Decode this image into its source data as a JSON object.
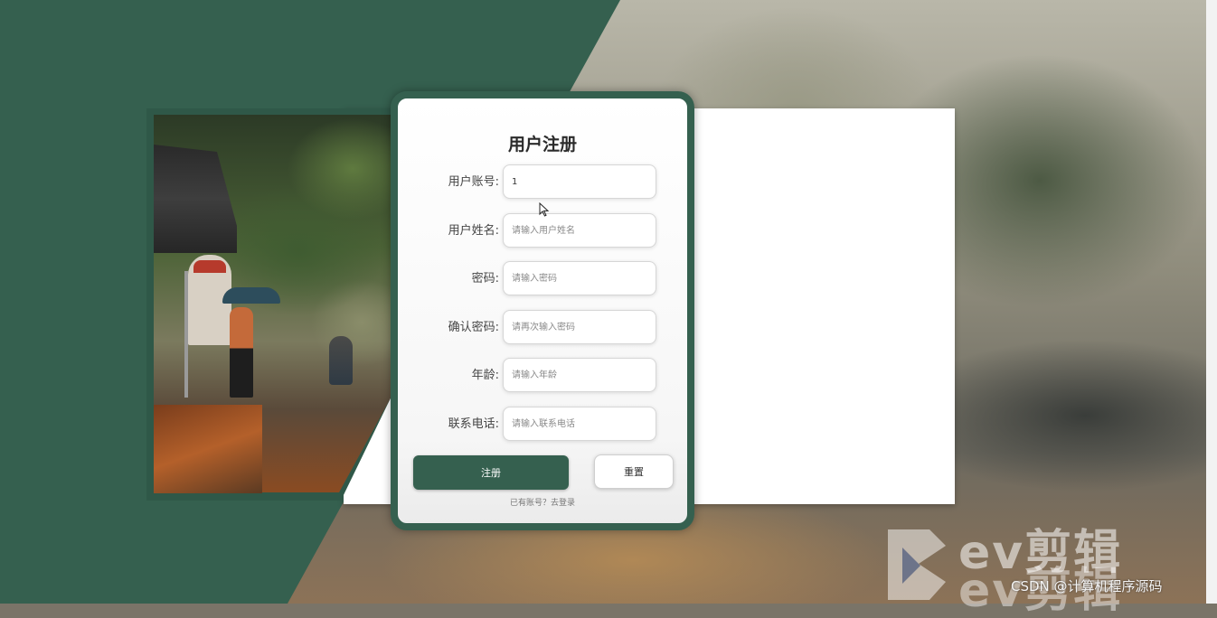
{
  "form": {
    "title": "用户注册",
    "fields": [
      {
        "label": "用户账号:",
        "value": "1",
        "placeholder": ""
      },
      {
        "label": "用户姓名:",
        "value": "",
        "placeholder": "请输入用户姓名"
      },
      {
        "label": "密码:",
        "value": "",
        "placeholder": "请输入密码"
      },
      {
        "label": "确认密码:",
        "value": "",
        "placeholder": "请再次输入密码"
      },
      {
        "label": "年龄:",
        "value": "",
        "placeholder": "请输入年龄"
      },
      {
        "label": "联系电话:",
        "value": "",
        "placeholder": "请输入联系电话"
      }
    ],
    "submit_label": "注册",
    "reset_label": "重置",
    "login_link": "已有账号？去登录"
  },
  "watermark": {
    "brand": "ev剪辑",
    "credit": "CSDN @计算机程序源码"
  },
  "colors": {
    "theme_green": "#35604f",
    "card_bg": "#ffffff"
  },
  "icons": {
    "cursor": "mouse-pointer-icon",
    "logo": "ev-logo-icon"
  }
}
